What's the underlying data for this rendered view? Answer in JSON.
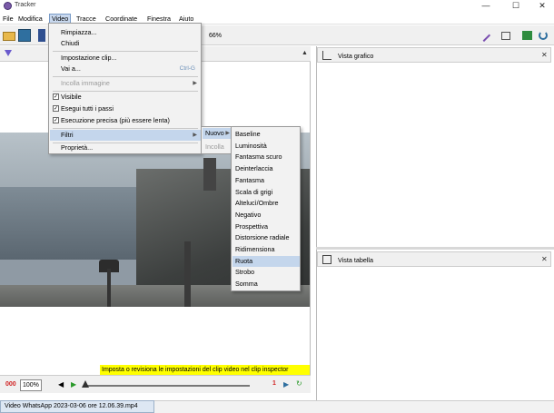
{
  "window": {
    "title": "Tracker",
    "minimize": "—",
    "maximize": "☐",
    "close": "✕"
  },
  "menubar": [
    "File",
    "Modifica",
    "Video",
    "Tracce",
    "Coordinate",
    "Finestra",
    "Aiuto"
  ],
  "toolbar": {
    "zoom": "66%"
  },
  "video_menu": {
    "items": {
      "rimpiazza": "Rimpiazza...",
      "chiudi": "Chiudi",
      "impostazione": "Impostazione clip...",
      "vai": "Vai a...",
      "vai_shortcut": "Ctrl-G",
      "incolla": "Incolla immagine",
      "visibile": "Visibile",
      "esegui": "Esegui tutti i passi",
      "esecuzione": "Esecuzione precisa (più essere lenta)",
      "filtri": "Filtri",
      "proprieta": "Proprietà..."
    }
  },
  "filters_submenu": {
    "nuovo": "Nuovo",
    "incolla": "Incolla"
  },
  "filters_list": [
    "Baseline",
    "Luminosità",
    "Fantasma scuro",
    "Deinterlaccia",
    "Fantasma",
    "Scala di grigi",
    "Altelucì/Ombre",
    "Negativo",
    "Prospettiva",
    "Distorsione radiale",
    "Ridimensiona",
    "Ruota",
    "Strobo",
    "Somma"
  ],
  "filters_highlighted": "Ruota",
  "right_panels": {
    "top": "Vista grafico",
    "bottom": "Vista tabella"
  },
  "status_hint": "Imposta o revisiona le impostazioni del clip video nel clip inspector",
  "player": {
    "counter": "000",
    "zoom": "100%",
    "frame": "1"
  },
  "file_tab": "Video WhatsApp 2023-03-06 ore 12.06.39.mp4",
  "colors": {
    "highlight": "#c4d6ec",
    "status_bg": "#ffff00",
    "counter": "#d02020"
  }
}
